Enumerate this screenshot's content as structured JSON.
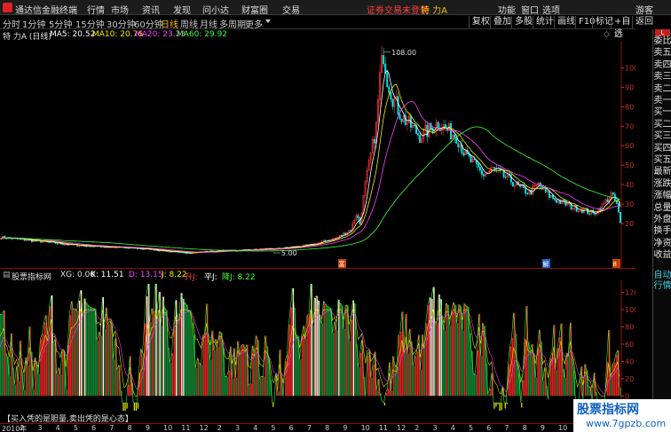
{
  "menubar": {
    "app_title": "通达信金融终端",
    "items": [
      "行情",
      "市场",
      "资讯",
      "发现",
      "问小达",
      "财富圈",
      "交易"
    ],
    "status_text": "证券交易未登录",
    "stock_tag": "特 力A",
    "right_items": [
      "功能",
      "窗口",
      "选项",
      "游客"
    ]
  },
  "toolbar": {
    "timeframes": [
      "分时",
      "1分钟",
      "5分钟",
      "15分钟",
      "30分钟",
      "60分钟",
      "日线",
      "周线",
      "月线",
      "多周期",
      "更多"
    ],
    "active_timeframe": "日线",
    "buttons": [
      "复权",
      "叠加",
      "多股",
      "统计",
      "画线",
      "F10",
      "标记",
      "+自选",
      "返回"
    ]
  },
  "infobar": {
    "stock": "特 力A (日线)",
    "ma5": "MA5: 20.52",
    "ma10": "MA10: 20.76",
    "ma20": "MA20: 23.23",
    "ma60": "MA60: 29.92",
    "colors": {
      "ma5": "#ffffff",
      "ma10": "#f0f000",
      "ma20": "#ff40ff",
      "ma60": "#40ff40"
    }
  },
  "right_panel": {
    "items": [
      "委比",
      "卖五",
      "卖四",
      "卖三",
      "卖二",
      "卖一",
      "买一",
      "买二",
      "买三",
      "买四",
      "买五",
      "最新",
      "涨跌",
      "涨幅",
      "总量",
      "外盘",
      "换手",
      "净资",
      "收益"
    ],
    "bottom_items": [
      "自动",
      "行情"
    ],
    "corner_label": "L"
  },
  "chart_data": [
    {
      "type": "candlestick",
      "name": "main-price-chart",
      "y_ticks": [
        20.0,
        30.0,
        40.0,
        50.0,
        60.0,
        70.0,
        80.0,
        90.0,
        100.0
      ],
      "ylim": [
        0,
        112
      ],
      "annotations": {
        "high": "108.00",
        "low": "5.00"
      },
      "markers": [
        "富",
        "解",
        "8"
      ],
      "anchors": [
        [
          0,
          13
        ],
        [
          40,
          9
        ],
        [
          80,
          7
        ],
        [
          100,
          5
        ],
        [
          120,
          6
        ],
        [
          150,
          7
        ],
        [
          170,
          9
        ],
        [
          185,
          13
        ],
        [
          192,
          17
        ],
        [
          195,
          25
        ],
        [
          197,
          20
        ],
        [
          200,
          40
        ],
        [
          203,
          55
        ],
        [
          206,
          70
        ],
        [
          208,
          95
        ],
        [
          210,
          108
        ],
        [
          212,
          95
        ],
        [
          215,
          85
        ],
        [
          220,
          75
        ],
        [
          225,
          70
        ],
        [
          230,
          65
        ],
        [
          235,
          68
        ],
        [
          240,
          72
        ],
        [
          245,
          68
        ],
        [
          250,
          65
        ],
        [
          255,
          55
        ],
        [
          260,
          50
        ],
        [
          265,
          45
        ],
        [
          270,
          48
        ],
        [
          275,
          45
        ],
        [
          280,
          42
        ],
        [
          285,
          38
        ],
        [
          290,
          36
        ],
        [
          295,
          40
        ],
        [
          300,
          35
        ],
        [
          305,
          32
        ],
        [
          310,
          30
        ],
        [
          315,
          28
        ],
        [
          320,
          27
        ],
        [
          325,
          25
        ],
        [
          330,
          29
        ],
        [
          335,
          35
        ],
        [
          338,
          30
        ],
        [
          340,
          20
        ]
      ],
      "ma_colors": [
        "#ffffff",
        "#f0f000",
        "#ff40ff",
        "#40ff40"
      ]
    },
    {
      "type": "bar",
      "name": "kdj-indicator",
      "y_ticks": [
        0,
        20,
        40,
        60,
        80,
        100,
        120
      ],
      "ylim": [
        -10,
        132
      ],
      "series": [
        {
          "name": "K",
          "color": "#f0f000"
        },
        {
          "name": "D",
          "color": "#ff40ff"
        },
        {
          "name": "J",
          "color": "#40ff40"
        }
      ]
    }
  ],
  "indicator": {
    "title": "股票指标网",
    "xg": "XG: 0.00",
    "k": "K: 11.51",
    "d": "D: 13.15",
    "j": "J: 8.22",
    "sheng": "升J:",
    "ping": "平J:",
    "jiang": "降J: 8.22",
    "colors": {
      "k": "#ffffff",
      "d": "#ff40ff",
      "j": "#f0f000",
      "sheng": "#ff4040",
      "ping": "#ffffff",
      "jiang": "#40ff40"
    }
  },
  "formula_text": "【买入凭的是胆量,卖出凭的是心态】",
  "date_axis": {
    "labels": [
      "2010年",
      "2",
      "3",
      "4",
      "5",
      "6",
      "7",
      "8",
      "9",
      "10",
      "11",
      "12",
      "2",
      "3",
      "4",
      "5",
      "6",
      "7",
      "8",
      "9",
      "10",
      "11",
      "12",
      "2",
      "3",
      "4",
      "5",
      "6",
      "7",
      "8",
      "9",
      "10",
      "11",
      "12",
      "1"
    ]
  },
  "watermark": {
    "line1": "股票指标网",
    "line2": "www.7gpzb.com"
  }
}
